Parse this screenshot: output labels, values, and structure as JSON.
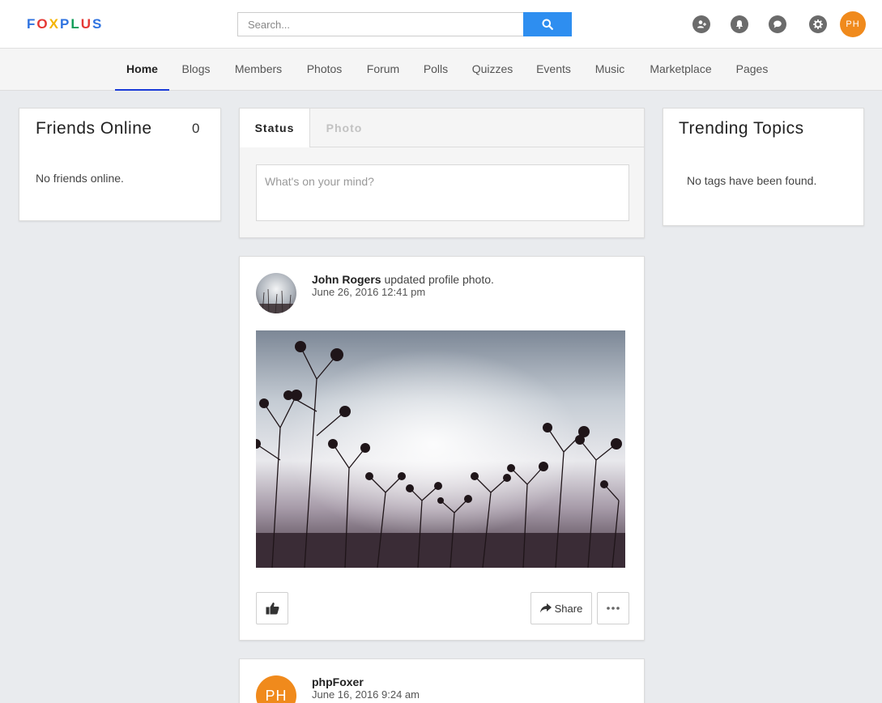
{
  "brand": {
    "letters": [
      {
        "char": "F",
        "color": "#2f73e0"
      },
      {
        "char": "O",
        "color": "#e53935"
      },
      {
        "char": "X",
        "color": "#f4b400"
      },
      {
        "char": "P",
        "color": "#2f73e0"
      },
      {
        "char": "L",
        "color": "#0f9d58"
      },
      {
        "char": "U",
        "color": "#e53935"
      },
      {
        "char": "S",
        "color": "#2f73e0"
      }
    ]
  },
  "search": {
    "placeholder": "Search..."
  },
  "topbar": {
    "icons": [
      "add-friend-icon",
      "bell-icon",
      "chat-icon",
      "gear-icon"
    ],
    "avatar_initials": "PH"
  },
  "nav": {
    "items": [
      "Home",
      "Blogs",
      "Members",
      "Photos",
      "Forum",
      "Polls",
      "Quizzes",
      "Events",
      "Music",
      "Marketplace",
      "Pages"
    ],
    "active": "Home"
  },
  "friends": {
    "title": "Friends Online",
    "count": "0",
    "empty": "No friends online."
  },
  "composer": {
    "tabs": [
      "Status",
      "Photo"
    ],
    "placeholder": "What's on your mind?"
  },
  "trending": {
    "title": "Trending Topics",
    "empty": "No tags have been found."
  },
  "posts": [
    {
      "author": "John Rogers",
      "action": "updated profile photo.",
      "time": "June 26, 2016 12:41 pm",
      "share_label": "Share"
    },
    {
      "author": "phpFoxer",
      "avatar_initials": "PH",
      "time": "June 16, 2016 9:24 am"
    }
  ],
  "colors": {
    "accent": "#2e8ef0",
    "nav_active": "#1a3bd8",
    "avatar": "#f08a1c"
  }
}
